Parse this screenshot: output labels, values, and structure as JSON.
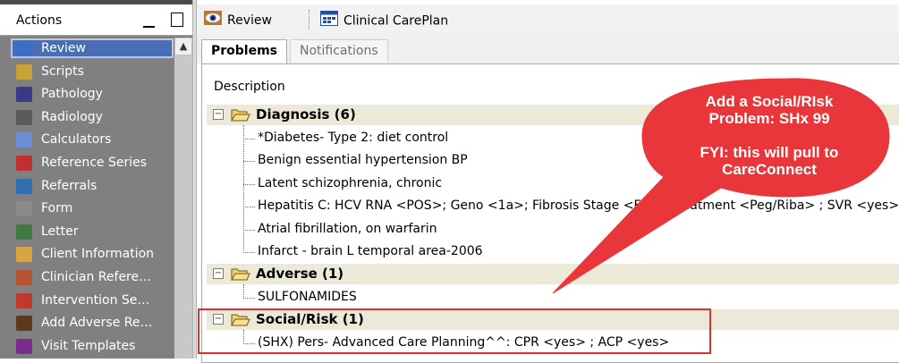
{
  "actions": {
    "title": "Actions",
    "items": [
      {
        "label": "Review",
        "icon": "eye-icon",
        "color": "#3b6fc4",
        "selected": true
      },
      {
        "label": "Scripts",
        "icon": "scripts-icon",
        "color": "#c9a23a"
      },
      {
        "label": "Pathology",
        "icon": "test-tube-icon",
        "color": "#3a3a8a"
      },
      {
        "label": "Radiology",
        "icon": "xray-icon",
        "color": "#5a5a5a"
      },
      {
        "label": "Calculators",
        "icon": "calculator-icon",
        "color": "#6a8fd6"
      },
      {
        "label": "Reference Series",
        "icon": "chart-icon",
        "color": "#c03030"
      },
      {
        "label": "Referrals",
        "icon": "referral-icon",
        "color": "#2e6fb0"
      },
      {
        "label": "Form",
        "icon": "form-icon",
        "color": "#8a8a8a"
      },
      {
        "label": "Letter",
        "icon": "letter-icon",
        "color": "#3f7a3f"
      },
      {
        "label": "Client Information",
        "icon": "client-icon",
        "color": "#d9a441"
      },
      {
        "label": "Clinician Refere…",
        "icon": "books-icon",
        "color": "#b3542e"
      },
      {
        "label": "Intervention Se…",
        "icon": "intervention-icon",
        "color": "#c0392b"
      },
      {
        "label": "Add Adverse Re…",
        "icon": "adverse-icon",
        "color": "#5a3a1a"
      },
      {
        "label": "Visit Templates",
        "icon": "visit-icon",
        "color": "#7a2e8a"
      }
    ]
  },
  "toolbar": {
    "review_label": "Review",
    "careplan_label": "Clinical CarePlan"
  },
  "tabs": [
    {
      "label": "Problems",
      "active": true
    },
    {
      "label": "Notifications",
      "active": false
    }
  ],
  "problems": {
    "column_header": "Description",
    "groups": [
      {
        "label": "Diagnosis (6)",
        "items": [
          "*Diabetes- Type 2: diet control",
          "Benign essential hypertension BP",
          "Latent schizophrenia, chronic",
          "Hepatitis C: HCV RNA <POS>; Geno <1a>; Fibrosis Stage <F3> ; Treatment <Peg/Riba> ; SVR <yes>",
          "Atrial fibrillation, on warfarin",
          "Infarct - brain L temporal area-2006"
        ]
      },
      {
        "label": "Adverse (1)",
        "items": [
          "SULFONAMIDES"
        ]
      },
      {
        "label": "Social/Risk (1)",
        "items": [
          "(SHX) Pers- Advanced Care Planning^^: CPR <yes> ; ACP <yes>"
        ]
      }
    ]
  },
  "callout": {
    "lines": [
      "Add a Social/RIsk",
      "Problem:  SHx 99",
      "",
      "FYI: this will pull to",
      "CareConnect"
    ],
    "color": "#e8363a"
  }
}
